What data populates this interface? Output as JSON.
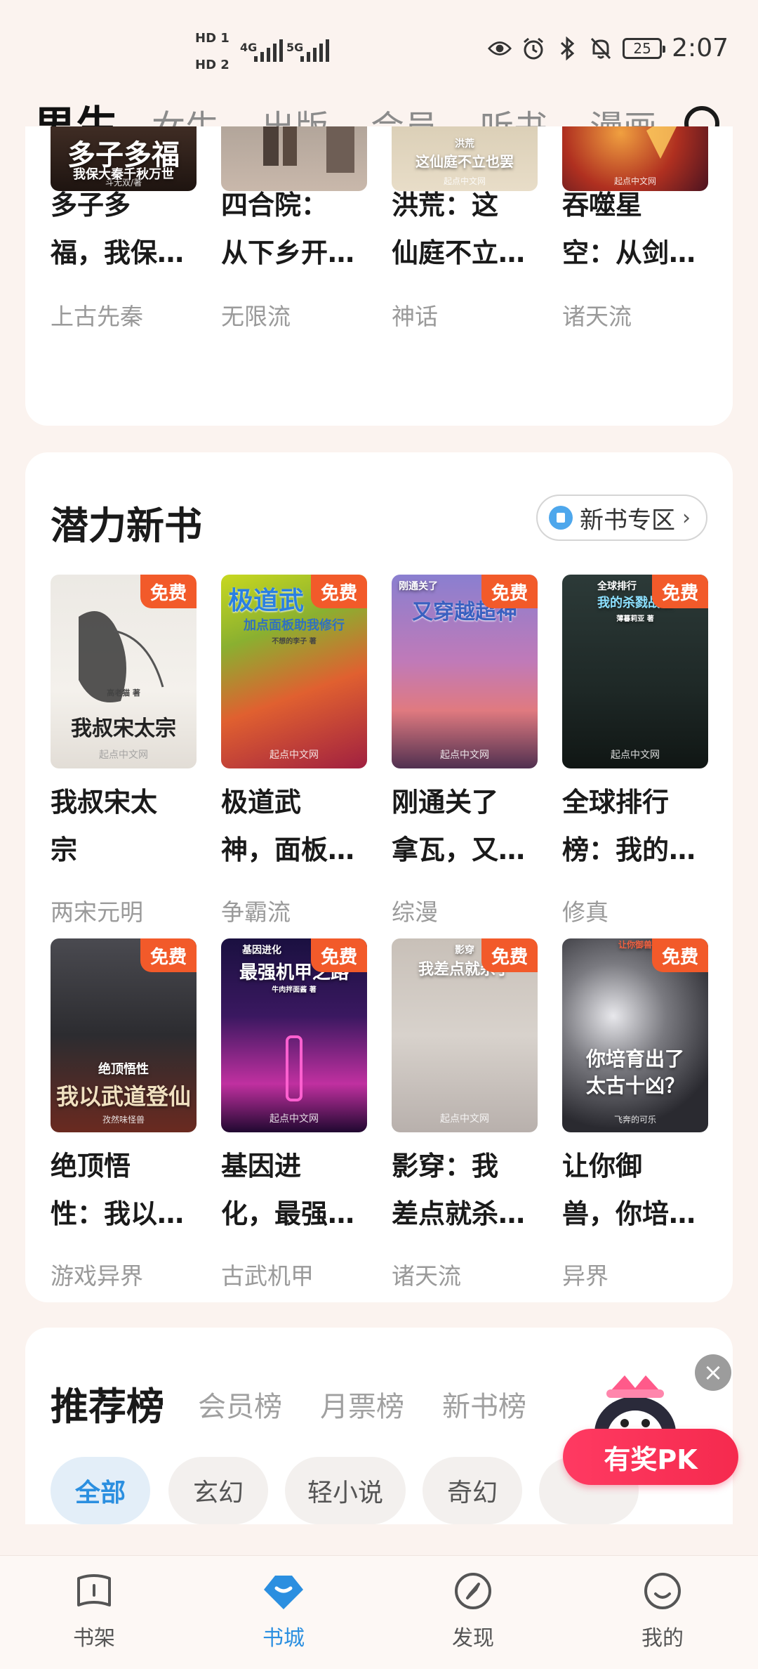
{
  "status_bar": {
    "hd1": "HD 1",
    "hd2": "HD 2",
    "net1": "4G",
    "net2": "5G",
    "battery": "25",
    "time": "2:07",
    "icons": [
      "eye-icon",
      "alarm-icon",
      "bluetooth-icon",
      "mute-icon",
      "battery-icon"
    ]
  },
  "top_tabs": [
    {
      "label": "男生",
      "active": true
    },
    {
      "label": "女生"
    },
    {
      "label": "出版"
    },
    {
      "label": "会员"
    },
    {
      "label": "听书"
    },
    {
      "label": "漫画"
    }
  ],
  "top_books": [
    {
      "title_line1": "多子多",
      "title_line2": "福，我保…",
      "tag": "上古先秦",
      "cover_text": "多子多福",
      "cover_sub": "我保大秦千秋万世",
      "cover_author": "斗无双/著"
    },
    {
      "title_line1": "四合院：",
      "title_line2": "从下乡开…",
      "tag": "无限流"
    },
    {
      "title_line1": "洪荒：这",
      "title_line2": "仙庭不立…",
      "tag": "神话",
      "cover_sub": "洪荒",
      "cover_text": "这仙庭不立也罢",
      "cover_pub": "起点中文网"
    },
    {
      "title_line1": "吞噬星",
      "title_line2": "空：从剑…",
      "tag": "诸天流",
      "cover_pub": "起点中文网"
    }
  ],
  "new_books": {
    "title": "潜力新书",
    "zone_button": "新书专区",
    "badge": "免费",
    "books": [
      {
        "title_line1": "我叔宋太",
        "title_line2": "宗",
        "tag": "两宋元明",
        "cover_text": "我叔宋太宗",
        "cover_author": "高老猫 著",
        "cover_pub": "起点中文网"
      },
      {
        "title_line1": "极道武",
        "title_line2": "神，面板…",
        "tag": "争霸流",
        "cover_text": "极道武",
        "cover_sub": "加点面板助我修行",
        "cover_author": "不想的李子 著",
        "cover_pub": "起点中文网"
      },
      {
        "title_line1": "刚通关了",
        "title_line2": "拿瓦，又…",
        "tag": "综漫",
        "cover_text": "又穿越超神",
        "cover_sub": "刚通关了",
        "cover_pub": "起点中文网"
      },
      {
        "title_line1": "全球排行",
        "title_line2": "榜：我的…",
        "tag": "修真",
        "cover_text": "我的杀戮战绩",
        "cover_sub": "全球排行",
        "cover_author": "薄暮莉亚 著",
        "cover_pub": "起点中文网"
      },
      {
        "title_line1": "绝顶悟",
        "title_line2": "性：我以…",
        "tag": "游戏异界",
        "cover_text": "我以武道登仙",
        "cover_sub": "绝顶悟性",
        "cover_author": "孜然味怪兽"
      },
      {
        "title_line1": "基因进",
        "title_line2": "化，最强…",
        "tag": "古武机甲",
        "cover_text": "最强机甲之路",
        "cover_sub": "基因进化",
        "cover_author": "牛肉拌面酱 著",
        "cover_pub": "起点中文网"
      },
      {
        "title_line1": "影穿：我",
        "title_line2": "差点就杀…",
        "tag": "诸天流",
        "cover_text": "我差点就杀了",
        "cover_sub": "影穿",
        "cover_pub": "起点中文网"
      },
      {
        "title_line1": "让你御",
        "title_line2": "兽，你培…",
        "tag": "异界",
        "cover_text": "你培育出了",
        "cover_text2": "太古十凶？",
        "cover_sub": "让你御兽",
        "cover_author": "飞奔的可乐"
      }
    ]
  },
  "ranking": {
    "title": "推荐榜",
    "tabs": [
      "会员榜",
      "月票榜",
      "新书榜"
    ],
    "chips": [
      "全部",
      "玄幻",
      "轻小说",
      "奇幻"
    ]
  },
  "promo": {
    "button": "有奖PK",
    "close": "×"
  },
  "bottom_nav": [
    {
      "label": "书架",
      "icon": "bookshelf-icon"
    },
    {
      "label": "书城",
      "icon": "bookstore-icon",
      "active": true
    },
    {
      "label": "发现",
      "icon": "compass-icon"
    },
    {
      "label": "我的",
      "icon": "profile-icon"
    }
  ],
  "colors": {
    "accent": "#2b8fe0",
    "free_badge": "#f25a2a",
    "promo": "#f52a4e",
    "background": "#fbf3ef"
  }
}
